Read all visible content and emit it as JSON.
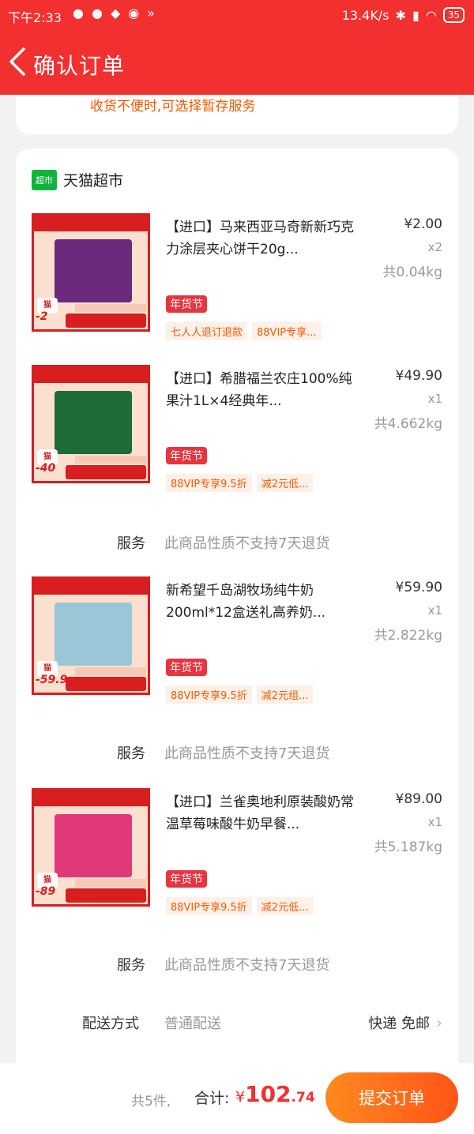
{
  "status_bar": {
    "time": "下午2:33",
    "net_speed": "13.4K/s",
    "battery": "35"
  },
  "nav": {
    "title": "确认订单"
  },
  "top_note": "收货不便时,可选择暂存服务",
  "shop": {
    "logo": "超市",
    "name": "天猫超市"
  },
  "items": [
    {
      "name": "【进口】马来西亚马奇新新巧克力涂层夹心饼干20g...",
      "price": "¥2.00",
      "qty": "x2",
      "weight": "共0.04kg",
      "festival": "年货节",
      "promos": [
        "七人人退订退款",
        "88VIP专享..."
      ],
      "thumb_price": "-2",
      "box_color": "#6b2a7c"
    },
    {
      "name": "【进口】希腊福兰农庄100%纯果汁1L×4经典年...",
      "price": "¥49.90",
      "qty": "x1",
      "weight": "共4.662kg",
      "festival": "年货节",
      "promos": [
        "88VIP专享9.5折",
        "减2元低..."
      ],
      "thumb_price": "-40",
      "box_color": "#1f6b3a"
    },
    {
      "name": "新希望千岛湖牧场纯牛奶200ml*12盒送礼高养奶...",
      "price": "¥59.90",
      "qty": "x1",
      "weight": "共2.822kg",
      "festival": "年货节",
      "promos": [
        "88VIP专享9.5折",
        "减2元组..."
      ],
      "thumb_price": "-59.9",
      "box_color": "#9ac7d8"
    },
    {
      "name": "【进口】兰雀奥地利原装酸奶常温草莓味酸牛奶早餐...",
      "price": "¥89.00",
      "qty": "x1",
      "weight": "共5.187kg",
      "festival": "年货节",
      "promos": [
        "88VIP专享9.5折",
        "减2元低..."
      ],
      "thumb_price": "-89",
      "box_color": "#e0397a"
    }
  ],
  "service": {
    "label": "服务",
    "value": "此商品性质不支持7天退货"
  },
  "delivery": {
    "label": "配送方式",
    "value": "普通配送",
    "right": "快递 免邮"
  },
  "footer": {
    "count": "共5件,",
    "sum_label": "合计:",
    "currency": "¥",
    "total_int": "102",
    "total_dec": ".74",
    "submit": "提交订单"
  },
  "colors": {
    "header": "#f23030",
    "accent": "#f15a00",
    "submit_start": "#ff8a1e",
    "submit_end": "#ff5418"
  }
}
